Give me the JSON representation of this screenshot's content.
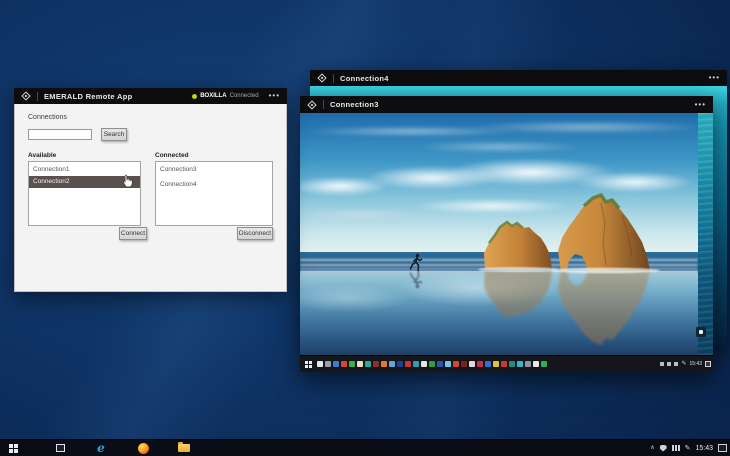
{
  "desktop": {
    "taskbar": {
      "start_label": "Start",
      "task_view_label": "Task View",
      "edge_label": "Microsoft Edge",
      "firefox_label": "Firefox",
      "explorer_label": "File Explorer",
      "tray": {
        "time": "15:43"
      }
    }
  },
  "emerald_app": {
    "window_title": "EMERALD Remote App",
    "status_brand": "BOXILLA",
    "status_state": "Connected",
    "status_color": "#c3d600",
    "menu_dots": "•••",
    "panel": {
      "heading": "Connections",
      "search_value": "",
      "search_button": "Search",
      "available_label": "Available",
      "available_items": [
        "Connection1",
        "Connection2"
      ],
      "available_selected_index": 1,
      "selection_color": "#5a504e",
      "connected_label": "Connected",
      "connected_items": [
        "Connection3",
        "Connection4"
      ],
      "connect_button": "Connect",
      "disconnect_button": "Disconnect"
    }
  },
  "connection4_window": {
    "title": "Connection4",
    "menu_dots": "•••"
  },
  "connection3_window": {
    "title": "Connection3",
    "menu_dots": "•••",
    "tray_time": "15:43",
    "taskbar_icon_colors": [
      "#e8e8e8",
      "#9aa0a8",
      "#3a7bd5",
      "#d9442c",
      "#3fae4a",
      "#e8dfc8",
      "#2ba8a0",
      "#8a2f2a",
      "#e07b28",
      "#5aa7e0",
      "#1f3f8f",
      "#cc3333",
      "#2e9db0",
      "#e4e4e4",
      "#2f9e44",
      "#2456b0",
      "#6ec6e8",
      "#d24538",
      "#7a2020",
      "#dcdcdc",
      "#c22f4a",
      "#2f6fd0",
      "#e0c22f",
      "#c83a2e",
      "#1f8a8a",
      "#35b5c8",
      "#8f949c",
      "#e8e8e8",
      "#2fae55"
    ]
  }
}
